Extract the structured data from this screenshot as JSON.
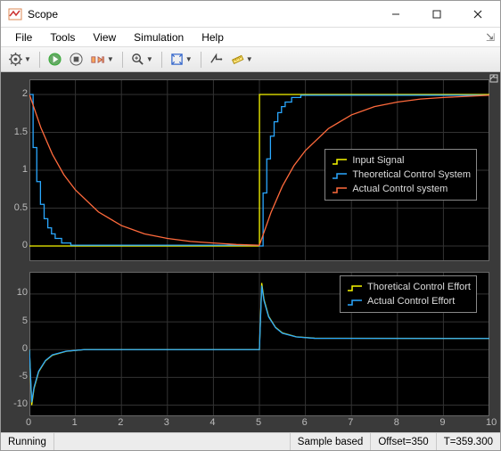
{
  "window": {
    "title": "Scope"
  },
  "menu": {
    "file": "File",
    "tools": "Tools",
    "view": "View",
    "simulation": "Simulation",
    "help": "Help"
  },
  "status": {
    "state": "Running",
    "mode": "Sample based",
    "offset": "Offset=350",
    "time": "T=359.300"
  },
  "icons": {
    "gear": "gear-icon",
    "run": "run-icon",
    "stop": "stop-icon",
    "step": "step-icon",
    "zoom": "zoom-icon",
    "autoscale": "autoscale-icon",
    "triggers": "triggers-icon",
    "measure": "measure-icon"
  },
  "colors": {
    "input": "#f7f700",
    "theoretical": "#2aa8ff",
    "actual": "#ff6a3c"
  },
  "legend1": {
    "s1": "Input Signal",
    "s2": "Theoretical Control System",
    "s3": "Actual Control system"
  },
  "legend2": {
    "s1": "Thoretical Control Effort",
    "s2": "Actual Control Effort"
  },
  "chart_data": [
    {
      "type": "line",
      "title": "",
      "xlabel": "",
      "ylabel": "",
      "xlim": [
        0,
        10
      ],
      "ylim": [
        -0.2,
        2.2
      ],
      "yticks": [
        0,
        0.5,
        1,
        1.5,
        2
      ],
      "xticks": [
        0,
        1,
        2,
        3,
        4,
        5,
        6,
        7,
        8,
        9,
        10
      ],
      "legend_position": "right",
      "series": [
        {
          "name": "Input Signal",
          "x": [
            0,
            0.001,
            5,
            5.001,
            10
          ],
          "y": [
            0,
            0,
            0,
            2,
            2
          ],
          "color": "#f7f700",
          "style": "step"
        },
        {
          "name": "Theoretical Control System",
          "x": [
            0,
            0.08,
            0.16,
            0.24,
            0.32,
            0.4,
            0.48,
            0.56,
            0.7,
            0.9,
            5,
            5.08,
            5.16,
            5.24,
            5.32,
            5.4,
            5.48,
            5.56,
            5.7,
            5.9,
            10
          ],
          "y": [
            2,
            1.3,
            0.85,
            0.55,
            0.36,
            0.24,
            0.16,
            0.1,
            0.04,
            0.01,
            0,
            0.7,
            1.15,
            1.45,
            1.64,
            1.76,
            1.84,
            1.9,
            1.96,
            1.99,
            2
          ],
          "color": "#2aa8ff",
          "style": "step"
        },
        {
          "name": "Actual Control system",
          "x": [
            0,
            0.25,
            0.5,
            0.75,
            1,
            1.5,
            2,
            2.5,
            3,
            3.5,
            4,
            4.5,
            5,
            5.25,
            5.5,
            5.75,
            6,
            6.5,
            7,
            7.5,
            8,
            8.5,
            9,
            10
          ],
          "y": [
            2,
            1.56,
            1.21,
            0.94,
            0.74,
            0.45,
            0.27,
            0.16,
            0.1,
            0.06,
            0.04,
            0.02,
            0.01,
            0.44,
            0.79,
            1.06,
            1.26,
            1.55,
            1.73,
            1.84,
            1.9,
            1.94,
            1.96,
            1.99
          ],
          "color": "#ff6a3c",
          "style": "line"
        }
      ]
    },
    {
      "type": "line",
      "title": "",
      "xlabel": "",
      "ylabel": "",
      "xlim": [
        0,
        10
      ],
      "ylim": [
        -12,
        14
      ],
      "yticks": [
        -10,
        -5,
        0,
        5,
        10
      ],
      "xticks": [
        0,
        1,
        2,
        3,
        4,
        5,
        6,
        7,
        8,
        9,
        10
      ],
      "legend_position": "top-right",
      "series": [
        {
          "name": "Thoretical Control Effort",
          "x": [
            0,
            0.05,
            0.1,
            0.2,
            0.35,
            0.5,
            0.8,
            1.2,
            5,
            5.05,
            5.1,
            5.2,
            5.35,
            5.5,
            5.8,
            6.2,
            10
          ],
          "y": [
            0,
            -10,
            -7,
            -4,
            -2,
            -1,
            -0.3,
            0,
            0,
            12,
            9,
            6,
            4,
            3,
            2.3,
            2.05,
            2
          ],
          "color": "#f7f700",
          "style": "line"
        },
        {
          "name": "Actual Control Effort",
          "x": [
            0,
            0.05,
            0.1,
            0.2,
            0.35,
            0.5,
            0.8,
            1.2,
            5,
            5.05,
            5.1,
            5.2,
            5.35,
            5.5,
            5.8,
            6.2,
            10
          ],
          "y": [
            0,
            -9.5,
            -6.8,
            -3.9,
            -1.95,
            -0.95,
            -0.28,
            0,
            0,
            11.5,
            8.8,
            5.9,
            3.95,
            2.95,
            2.28,
            2.03,
            2
          ],
          "color": "#2aa8ff",
          "style": "line"
        }
      ]
    }
  ]
}
